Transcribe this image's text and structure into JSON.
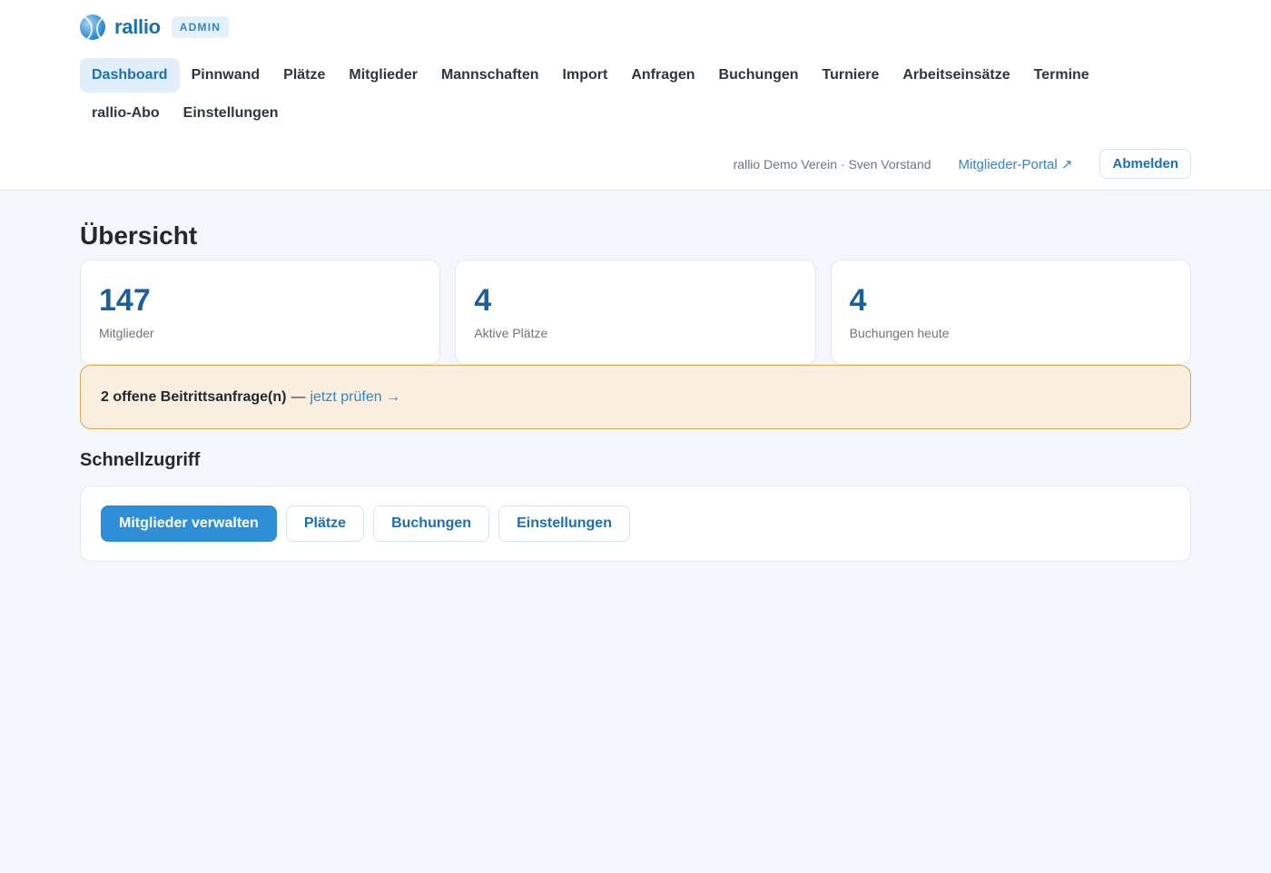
{
  "brand": {
    "name": "rallio",
    "badge": "ADMIN",
    "logo_icon": "tennis-ball-icon"
  },
  "nav": {
    "items": [
      {
        "label": "Dashboard",
        "active": true
      },
      {
        "label": "Pinnwand",
        "active": false
      },
      {
        "label": "Plätze",
        "active": false
      },
      {
        "label": "Mitglieder",
        "active": false
      },
      {
        "label": "Mannschaften",
        "active": false
      },
      {
        "label": "Import",
        "active": false
      },
      {
        "label": "Anfragen",
        "active": false
      },
      {
        "label": "Buchungen",
        "active": false
      },
      {
        "label": "Turniere",
        "active": false
      },
      {
        "label": "Arbeitseinsätze",
        "active": false
      },
      {
        "label": "Termine",
        "active": false
      },
      {
        "label": "rallio-Abo",
        "active": false
      },
      {
        "label": "Einstellungen",
        "active": false
      }
    ]
  },
  "user": {
    "club_and_name": "rallio Demo Verein · Sven Vorstand",
    "portal_link": "Mitglieder-Portal ↗",
    "logout_label": "Abmelden"
  },
  "overview": {
    "title": "Übersicht",
    "stats": [
      {
        "value": "147",
        "label": "Mitglieder"
      },
      {
        "value": "4",
        "label": "Aktive Plätze"
      },
      {
        "value": "4",
        "label": "Buchungen heute"
      }
    ]
  },
  "notice": {
    "text": "2 offene Beitrittsanfrage(n)",
    "separator": "—",
    "link": "jetzt prüfen →"
  },
  "quick_access": {
    "title": "Schnellzugriff",
    "buttons": [
      {
        "label": "Mitglieder verwalten",
        "primary": true
      },
      {
        "label": "Plätze",
        "primary": false
      },
      {
        "label": "Buchungen",
        "primary": false
      },
      {
        "label": "Einstellungen",
        "primary": false
      }
    ]
  },
  "colors": {
    "accent": "#1b6fb5",
    "primary_button": "#2f8fd6",
    "notice_bg": "#faefdf",
    "notice_border": "#d9a55a",
    "page_bg": "#f3f7fb"
  }
}
